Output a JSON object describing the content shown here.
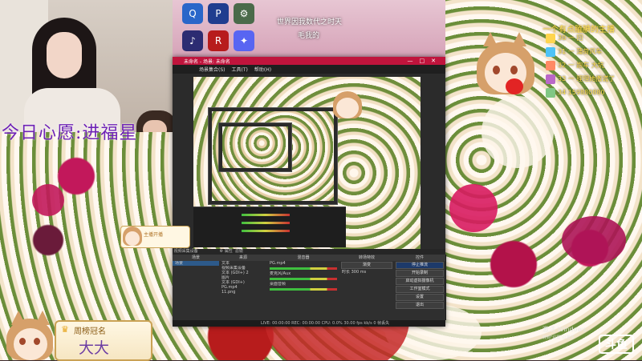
{
  "desktop": {
    "title": "世界因我数代之时天",
    "subtitle": "毛我的",
    "icons": [
      {
        "label": "Q",
        "color": "#2a66c9"
      },
      {
        "label": "P",
        "color": "#1f3d8f"
      },
      {
        "label": "⚙",
        "color": "#4a6a4a"
      },
      {
        "label": "♪",
        "color": "#2c2c72"
      },
      {
        "label": "R",
        "color": "#b71c1c"
      },
      {
        "label": "✦",
        "color": "#5865f2"
      }
    ]
  },
  "marquee": {
    "text": "今日心愿:进福星"
  },
  "obs": {
    "window_title": "未命名 - 场景: 未命名",
    "menu": [
      "场景集合(S)",
      "工具(T)",
      "帮助(H)"
    ],
    "window_controls": "—□✕",
    "docks": {
      "scenes": {
        "header": "场景",
        "items": [
          "场景"
        ]
      },
      "sources": {
        "header": "来源",
        "items": [
          "文本",
          "视频采集设备",
          "文本 (GDI+) 2",
          "图片",
          "文本 (GDI+)",
          "PG.mp4",
          "11.png"
        ]
      },
      "mixer": {
        "header": "混音器",
        "tracks": [
          "PG.mp4",
          "麦克风/Aux",
          "桌面音频"
        ]
      },
      "transitions": {
        "header": "转场特效",
        "fade": "渐变",
        "duration_label": "时长",
        "duration": "300 ms"
      },
      "controls": {
        "header": "控件",
        "buttons": [
          "停止推流",
          "开始录制",
          "启动虚拟摄像机",
          "工作室模式",
          "设置",
          "退出"
        ]
      }
    },
    "source_bar": "视频采集设备",
    "properties_tab": "属性",
    "filters_tab": "滤镜",
    "status": "LIVE: 00:00:00  REC: 00:00:00  CPU: 0.0%  30.00 fps  kb/s  0 帧丢失"
  },
  "chat": {
    "title": "一个有点腼腆的主播",
    "messages": [
      {
        "level": "30",
        "text": "30 一 回",
        "color": "#ffd54f"
      },
      {
        "level": "31",
        "text": "31 一 蒲荷风车",
        "color": "#4fc3f7"
      },
      {
        "level": "32",
        "text": "32 一 跑车 大坑",
        "color": "#ff8a65"
      },
      {
        "level": "33",
        "text": "33 一 理理她撒谎了",
        "color": "#ba68c8"
      },
      {
        "level": "34",
        "text": "34 159880880",
        "color": "#81c784"
      }
    ]
  },
  "rank": {
    "title": "周榜冠名",
    "name": "大大"
  },
  "preview_badge": "主播开播",
  "windows_activation": {
    "line1": "激活 Windows",
    "line2": "转到\"设置\"以激活"
  },
  "platform_logo": "斗鱼",
  "colors": {
    "obs_title": "#c0143c",
    "accent_purple": "#6e22b5",
    "gold": "#ffe14d"
  }
}
